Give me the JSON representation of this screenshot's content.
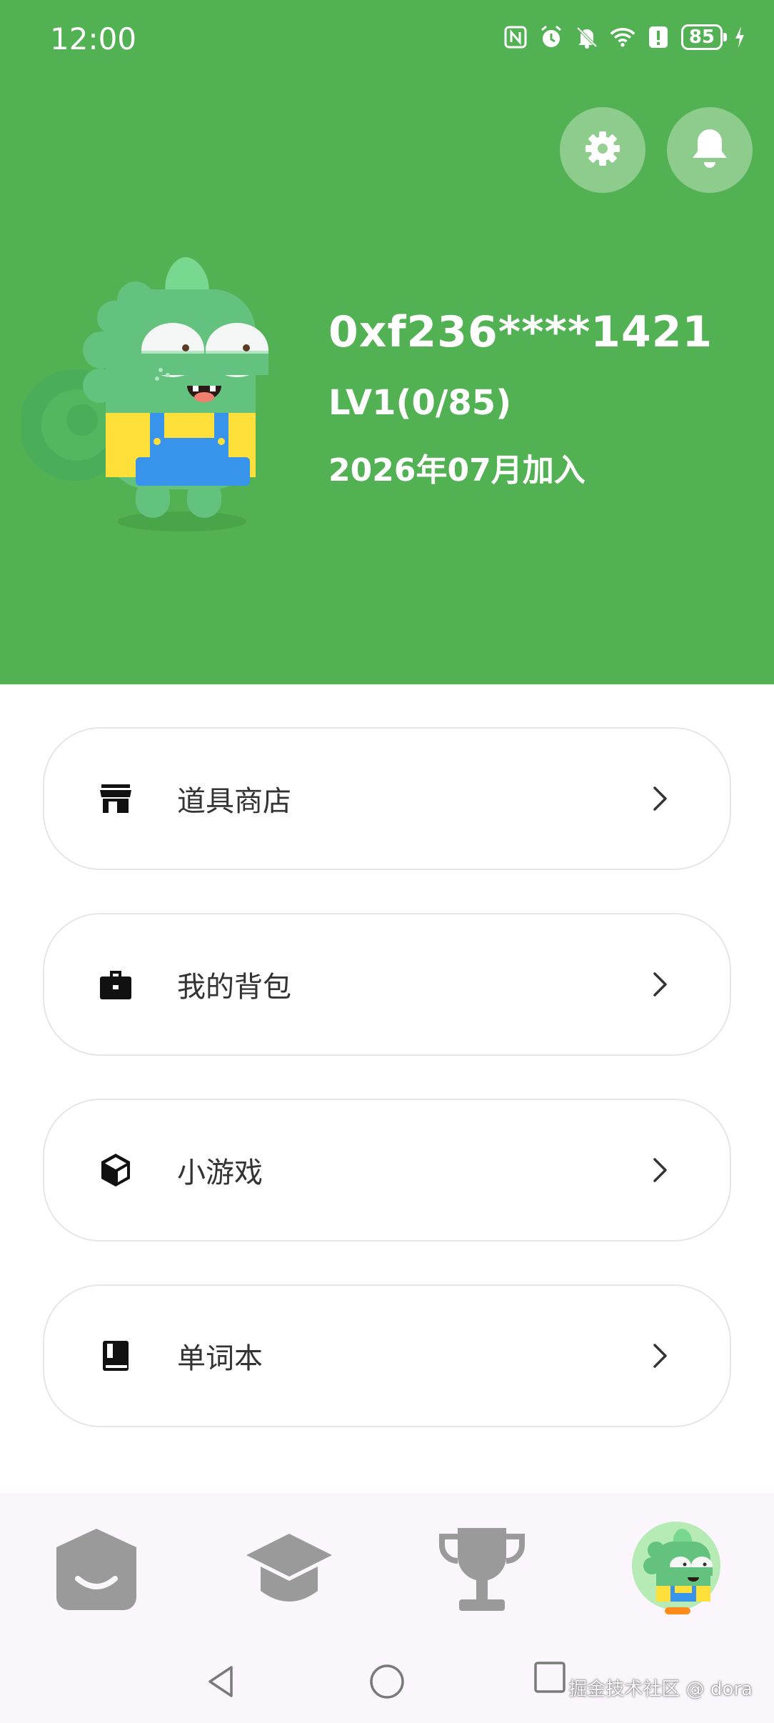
{
  "status_bar": {
    "time": "12:00",
    "battery": "85",
    "icons": [
      "nfc-icon",
      "alarm-icon",
      "bell-off-icon",
      "wifi-icon",
      "alert-icon",
      "battery-icon",
      "charging-icon"
    ]
  },
  "header": {
    "background": "#52b152",
    "settings_icon": "gear-icon",
    "notification_icon": "bell-icon"
  },
  "profile": {
    "user_id": "0xf236****1421",
    "level": "LV1(0/85)",
    "joined": "2026年07月加入"
  },
  "menu": [
    {
      "label": "道具商店",
      "icon": "store-icon"
    },
    {
      "label": "我的背包",
      "icon": "briefcase-icon"
    },
    {
      "label": "小游戏",
      "icon": "cube-icon"
    },
    {
      "label": "单词本",
      "icon": "book-icon"
    }
  ],
  "bottom_nav": [
    {
      "icon": "home-icon"
    },
    {
      "icon": "graduation-cap-icon"
    },
    {
      "icon": "trophy-icon"
    },
    {
      "icon": "profile-avatar-icon",
      "active": true
    }
  ],
  "watermark": "掘金技术社区 @ dora"
}
